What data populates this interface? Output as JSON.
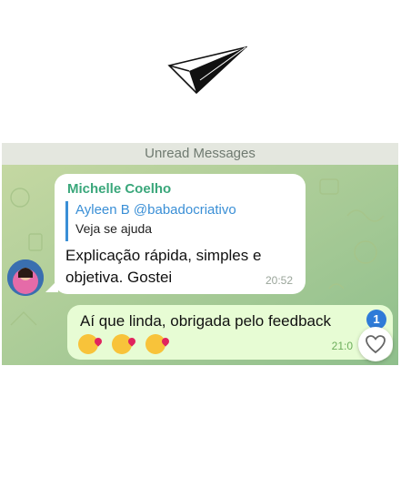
{
  "unread_label": "Unread Messages",
  "incoming": {
    "sender": "Michelle Coelho",
    "reply_to_name": "Ayleen B @babadocriativo",
    "reply_to_text": "Veja se ajuda",
    "text": "Explicação rápida, simples e objetiva. Gostei",
    "time": "20:52"
  },
  "outgoing": {
    "text": "Aí que linda, obrigada pelo feedback",
    "emojis": [
      "kissing-heart-emoji",
      "kissing-heart-emoji",
      "kissing-heart-emoji"
    ],
    "time": "21:0"
  },
  "badge_count": "1",
  "icons": {
    "plane": "paper-plane-icon",
    "heart": "heart-icon"
  },
  "colors": {
    "sender": "#3aa77b",
    "reply_accent": "#3a8fd6",
    "chat_background": "#b8cf98",
    "outgoing_bubble": "#e7fcd4",
    "badge": "#2f7bd8"
  }
}
